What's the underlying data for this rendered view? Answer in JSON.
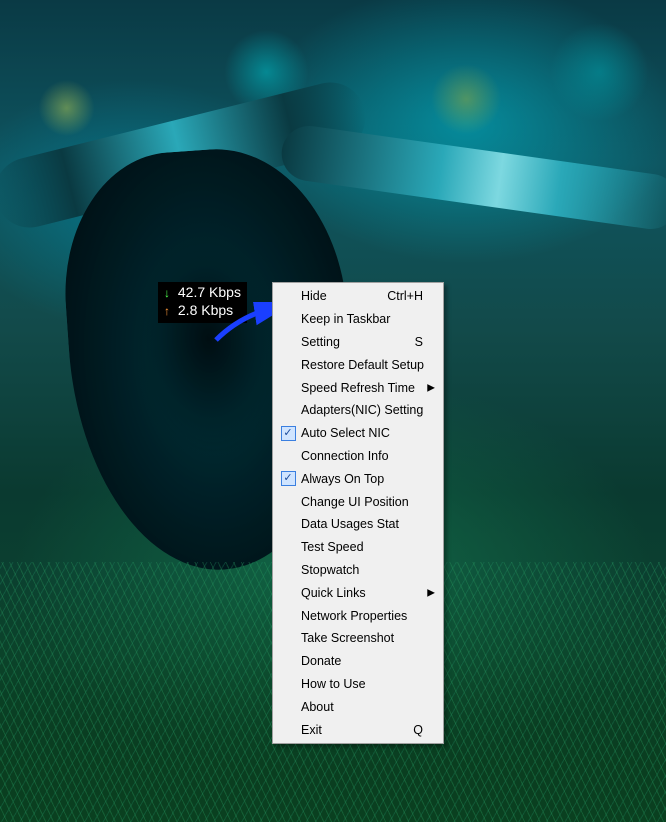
{
  "speed_widget": {
    "download_value": "42.7 Kbps",
    "upload_value": "2.8 Kbps"
  },
  "context_menu": {
    "items": [
      {
        "id": "hide",
        "label": "Hide",
        "shortcut": "Ctrl+H",
        "checked": false,
        "submenu": false
      },
      {
        "id": "keep-in-taskbar",
        "label": "Keep in Taskbar",
        "shortcut": "",
        "checked": false,
        "submenu": false
      },
      {
        "id": "setting",
        "label": "Setting",
        "shortcut": "S",
        "checked": false,
        "submenu": false
      },
      {
        "id": "restore-default",
        "label": "Restore Default Setup",
        "shortcut": "",
        "checked": false,
        "submenu": false
      },
      {
        "id": "speed-refresh",
        "label": "Speed Refresh Time",
        "shortcut": "",
        "checked": false,
        "submenu": true
      },
      {
        "id": "adapters-nic",
        "label": "Adapters(NIC) Setting",
        "shortcut": "",
        "checked": false,
        "submenu": false
      },
      {
        "id": "auto-select-nic",
        "label": "Auto Select NIC",
        "shortcut": "",
        "checked": true,
        "submenu": false
      },
      {
        "id": "connection-info",
        "label": "Connection Info",
        "shortcut": "",
        "checked": false,
        "submenu": false
      },
      {
        "id": "always-on-top",
        "label": "Always On Top",
        "shortcut": "",
        "checked": true,
        "submenu": false
      },
      {
        "id": "change-ui-position",
        "label": "Change UI Position",
        "shortcut": "",
        "checked": false,
        "submenu": false
      },
      {
        "id": "data-usages-stat",
        "label": "Data Usages Stat",
        "shortcut": "",
        "checked": false,
        "submenu": false
      },
      {
        "id": "test-speed",
        "label": "Test Speed",
        "shortcut": "",
        "checked": false,
        "submenu": false
      },
      {
        "id": "stopwatch",
        "label": "Stopwatch",
        "shortcut": "",
        "checked": false,
        "submenu": false
      },
      {
        "id": "quick-links",
        "label": "Quick Links",
        "shortcut": "",
        "checked": false,
        "submenu": true
      },
      {
        "id": "network-properties",
        "label": "Network Properties",
        "shortcut": "",
        "checked": false,
        "submenu": false
      },
      {
        "id": "take-screenshot",
        "label": "Take Screenshot",
        "shortcut": "",
        "checked": false,
        "submenu": false
      },
      {
        "id": "donate",
        "label": "Donate",
        "shortcut": "",
        "checked": false,
        "submenu": false
      },
      {
        "id": "how-to-use",
        "label": "How to Use",
        "shortcut": "",
        "checked": false,
        "submenu": false
      },
      {
        "id": "about",
        "label": "About",
        "shortcut": "",
        "checked": false,
        "submenu": false
      },
      {
        "id": "exit",
        "label": "Exit",
        "shortcut": "Q",
        "checked": false,
        "submenu": false
      }
    ]
  }
}
